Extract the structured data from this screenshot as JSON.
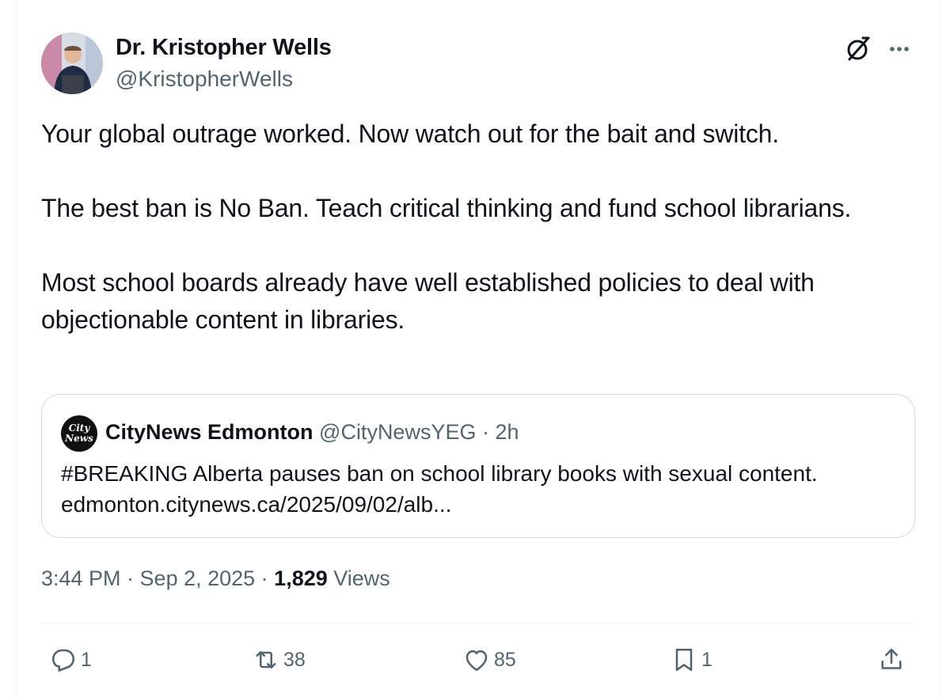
{
  "author": {
    "display_name": "Dr. Kristopher Wells",
    "handle": "@KristopherWells"
  },
  "header_icons": {
    "grok": "grok-icon",
    "more": "more-icon"
  },
  "tweet": {
    "paragraphs": [
      "Your global outrage worked. Now watch out for the bait and switch.",
      "The best ban is No Ban. Teach critical thinking and fund school librarians.",
      "Most school boards already have well established policies to deal with objectionable content in libraries."
    ]
  },
  "quote": {
    "logo_text_1": "City",
    "logo_text_2": "News",
    "name": "CityNews Edmonton",
    "meta": "@CityNewsYEG · 2h",
    "text_line_1": "#BREAKING Alberta pauses ban on school library books with sexual content.",
    "text_line_2": "edmonton.citynews.ca/2025/09/02/alb..."
  },
  "meta": {
    "timestamp": "3:44 PM · Sep 2, 2025 · ",
    "views_count": "1,829",
    "views_label": " Views"
  },
  "actions": {
    "reply": {
      "icon": "reply-icon",
      "count": "1"
    },
    "retweet": {
      "icon": "retweet-icon",
      "count": "38"
    },
    "like": {
      "icon": "heart-icon",
      "count": "85"
    },
    "bookmark": {
      "icon": "bookmark-icon",
      "count": "1"
    },
    "share": {
      "icon": "share-icon"
    }
  },
  "colors": {
    "text": "#0f1419",
    "secondary": "#536471",
    "border": "#cfd9de",
    "divider": "#eff3f4"
  }
}
